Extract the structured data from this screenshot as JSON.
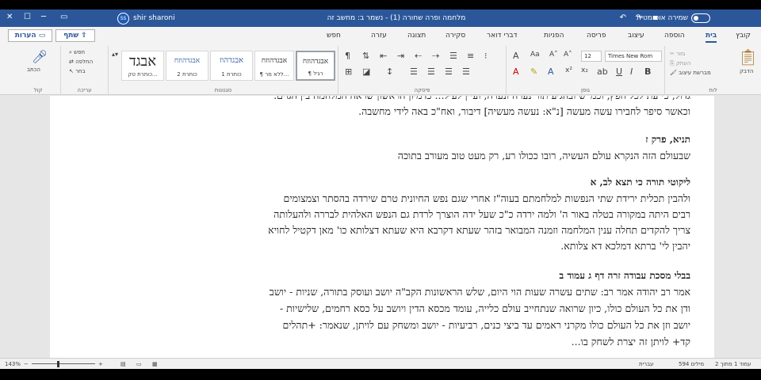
{
  "titlebar": {
    "autosave": "שמירה אוטומטית",
    "doc_title": "מלחמה ופרה שחורה (1) - נשמר ב: מחשב זה",
    "user": "shir sharoni",
    "initials": "SS"
  },
  "tabs": [
    "קובץ",
    "בית",
    "הוספה",
    "עיצוב",
    "פריסה",
    "הפניות",
    "דברי דואר",
    "סקירה",
    "תצוגה",
    "עזרה",
    "חפש"
  ],
  "active_tab": "בית",
  "comments_label": "הערות",
  "share_label": "שתף",
  "ribbon": {
    "clipboard": {
      "label": "לוח",
      "paste": "הדבק",
      "cut": "גזור",
      "copy": "העתק",
      "format_painter": "מברשת עיצוב"
    },
    "font": {
      "label": "גופן",
      "name": "Times New Rom",
      "size": "12"
    },
    "paragraph": {
      "label": "פיסקה"
    },
    "styles": {
      "label": "סגנונות",
      "items": [
        {
          "sample": "אבגדהוזח",
          "name": "¶ רגיל"
        },
        {
          "sample": "אבגדהוזח",
          "name": "¶ ללא מר..."
        },
        {
          "sample": "אבגדהוז",
          "name": "כותרת 1"
        },
        {
          "sample": "אבגדהוזח",
          "name": "כותרת 2"
        },
        {
          "sample": "אבגד",
          "name": "כותרת טק..."
        }
      ]
    },
    "editing": {
      "label": "עריכה",
      "find": "חפש",
      "replace": "החלפה",
      "select": "בחר"
    },
    "voice": {
      "label": "קול",
      "dictate": "הכתב"
    }
  },
  "document": {
    "lines": [
      {
        "text": "גדול, כי עת לכל חפץ, וכמ\"ש ובהגיע תור נערה ונערה, ועיין לעיל... כדמיון הראשון שראה המלחמה בין הגוים.",
        "type": "body"
      },
      {
        "text": "וכאשר סיפר לחבירו עשה מעשה [נ\"א: נעשה מעשיה] דיבור, ואח\"כ באה לידי מחשבה.",
        "type": "body"
      },
      {
        "text": "תניא, פרק ז",
        "type": "heading"
      },
      {
        "text": "שבעולם הזה הנקרא עולם העשיה, רובו ככולו רע, רק מעט טוב מעורב בתוכה",
        "type": "body"
      },
      {
        "text": "ליקוטי תורה כי תצא לב, א",
        "type": "heading"
      },
      {
        "text": "ולהבין תכלית ירידת שתי הנפשות למלחמתם בעוה\"ז אחרי שגם נפש החיונית טרם שירדה בהסתר וצמצומים",
        "type": "body"
      },
      {
        "text": "רבים היתה במקורה בטלה באור ה' ולמה ירדה כ\"כ שעל ידה הוצרך לרדת גם הנפש האלהית לבררה ולהעלותה",
        "type": "body"
      },
      {
        "text": "צריך להקדים תחלה ענין המלחמה וזמנה המבואר בזהר שעתא דקרבא היא שעתא דצלותא כו' מאן דקטיל לחויא",
        "type": "body"
      },
      {
        "text": "יהבין לי' ברתא דמלכא דא צלותא.",
        "type": "body"
      },
      {
        "text": "בבלי מסכת עבודה זרה דף ג עמוד ב",
        "type": "heading"
      },
      {
        "text": "אמר רב יהודה אמר רב: שתים עשרה שעות הוי היום, שלש הראשונות הקב\"ה יושב ועוסק בתורה, שניות - יושב",
        "type": "body"
      },
      {
        "text": "ודן את כל העולם כולו, כיון שרואה שנתחייב עולם כלייה, עומד מכסא הדין ויושב על כסא רחמים, שלישיות -",
        "type": "body"
      },
      {
        "text": "יושב וזן את כל העולם כולו מקרני ראמים עד ביצי כנים, רביעיות - יושב ומשחק עם לויתן, שנאמר: +תהלים",
        "type": "body"
      },
      {
        "text": "קד+ לויתן זה יצרת לשחק בו...",
        "type": "body"
      }
    ]
  },
  "status": {
    "page": "עמוד 1 מתוך 2",
    "words": "594 מילים",
    "language": "עברית",
    "zoom": "143%"
  }
}
